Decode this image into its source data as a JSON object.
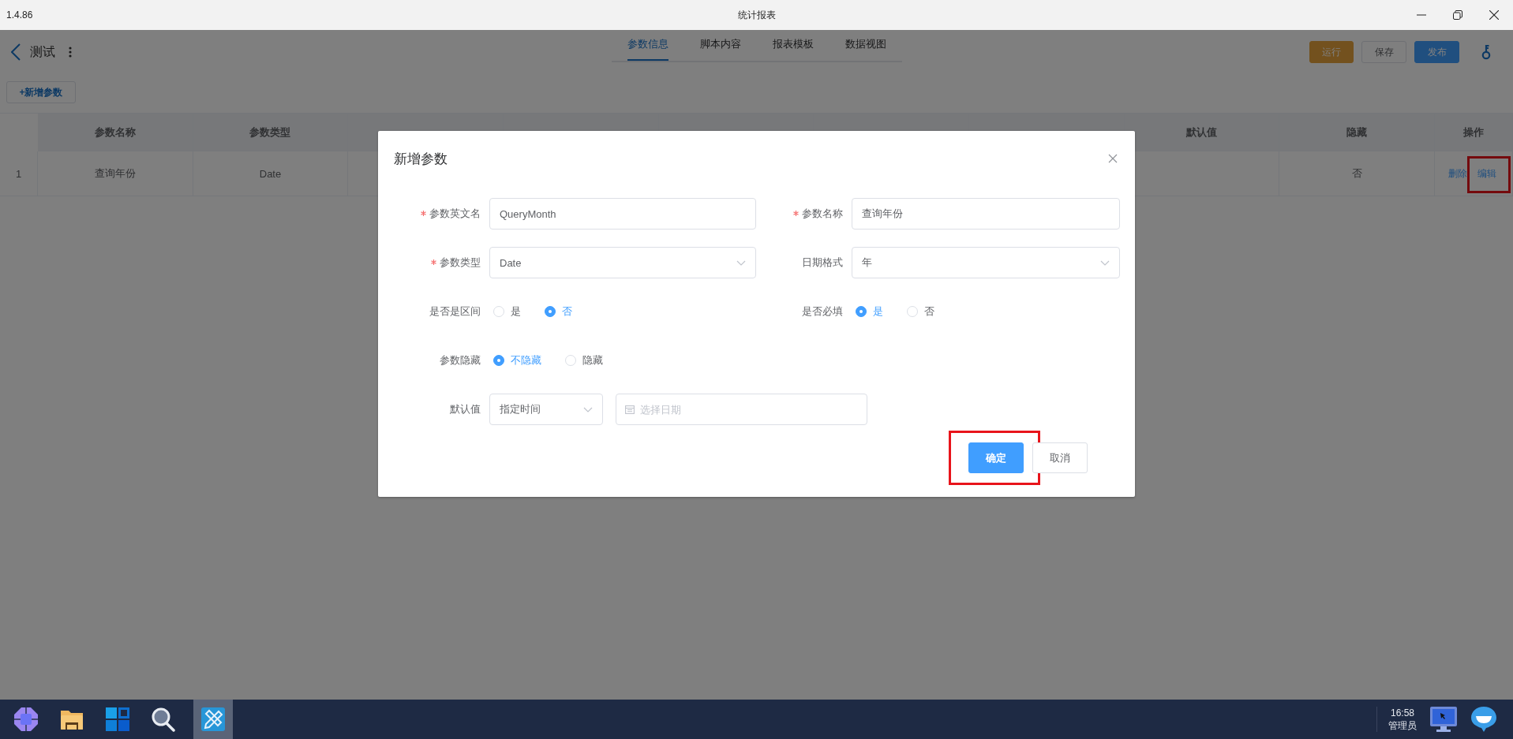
{
  "window": {
    "version": "1.4.86",
    "title": "统计报表"
  },
  "header": {
    "title": "测试",
    "tabs": [
      {
        "label": "参数信息",
        "selected": true
      },
      {
        "label": "脚本内容",
        "selected": false
      },
      {
        "label": "报表模板",
        "selected": false
      },
      {
        "label": "数据视图",
        "selected": false
      }
    ],
    "buttons": [
      {
        "label": "运行",
        "kind": "warning"
      },
      {
        "label": "保存",
        "kind": "plain"
      },
      {
        "label": "发布",
        "kind": "primary"
      }
    ]
  },
  "add_button": "+新增参数",
  "table": {
    "columns_left": [
      "参数名称",
      "参数类型"
    ],
    "columns_right": [
      "默认值",
      "隐藏",
      "操作"
    ],
    "rows": [
      {
        "index": "1",
        "name": "查询年份",
        "type": "Date",
        "hidden": "否",
        "actions": [
          {
            "label": "删除",
            "highlighted": false
          },
          {
            "label": "编辑",
            "highlighted": true
          }
        ]
      }
    ]
  },
  "dialog": {
    "title": "新增参数",
    "fields": [
      {
        "kind": "input",
        "label": "参数英文名",
        "required": true,
        "value": "QueryMonth"
      },
      {
        "kind": "input",
        "label": "参数名称",
        "required": true,
        "value": "查询年份"
      },
      {
        "kind": "select",
        "label": "参数类型",
        "required": true,
        "value": "Date"
      },
      {
        "kind": "select",
        "label": "日期格式",
        "required": false,
        "value": "年"
      },
      {
        "kind": "radio",
        "label": "是否是区间",
        "options": [
          {
            "label": "是",
            "selected": false
          },
          {
            "label": "否",
            "selected": true
          }
        ]
      },
      {
        "kind": "radio",
        "label": "是否必填",
        "options": [
          {
            "label": "是",
            "selected": true
          },
          {
            "label": "否",
            "selected": false
          }
        ]
      },
      {
        "kind": "radio",
        "label": "参数隐藏",
        "options": [
          {
            "label": "不隐藏",
            "selected": true
          },
          {
            "label": "隐藏",
            "selected": false
          }
        ]
      },
      {
        "kind": "default",
        "label": "默认值",
        "value": "指定时间",
        "placeholder": "选择日期"
      }
    ],
    "buttons": [
      {
        "label": "确定",
        "kind": "primary",
        "highlighted": true
      },
      {
        "label": "取消",
        "kind": "plain",
        "highlighted": false
      }
    ]
  },
  "taskbar": {
    "apps": [
      {
        "kind": "launcher",
        "selected": false
      },
      {
        "kind": "files",
        "selected": false
      },
      {
        "kind": "start",
        "selected": false
      },
      {
        "kind": "search",
        "selected": false
      },
      {
        "kind": "design",
        "selected": true
      }
    ],
    "time": "16:58",
    "user": "管理员"
  }
}
